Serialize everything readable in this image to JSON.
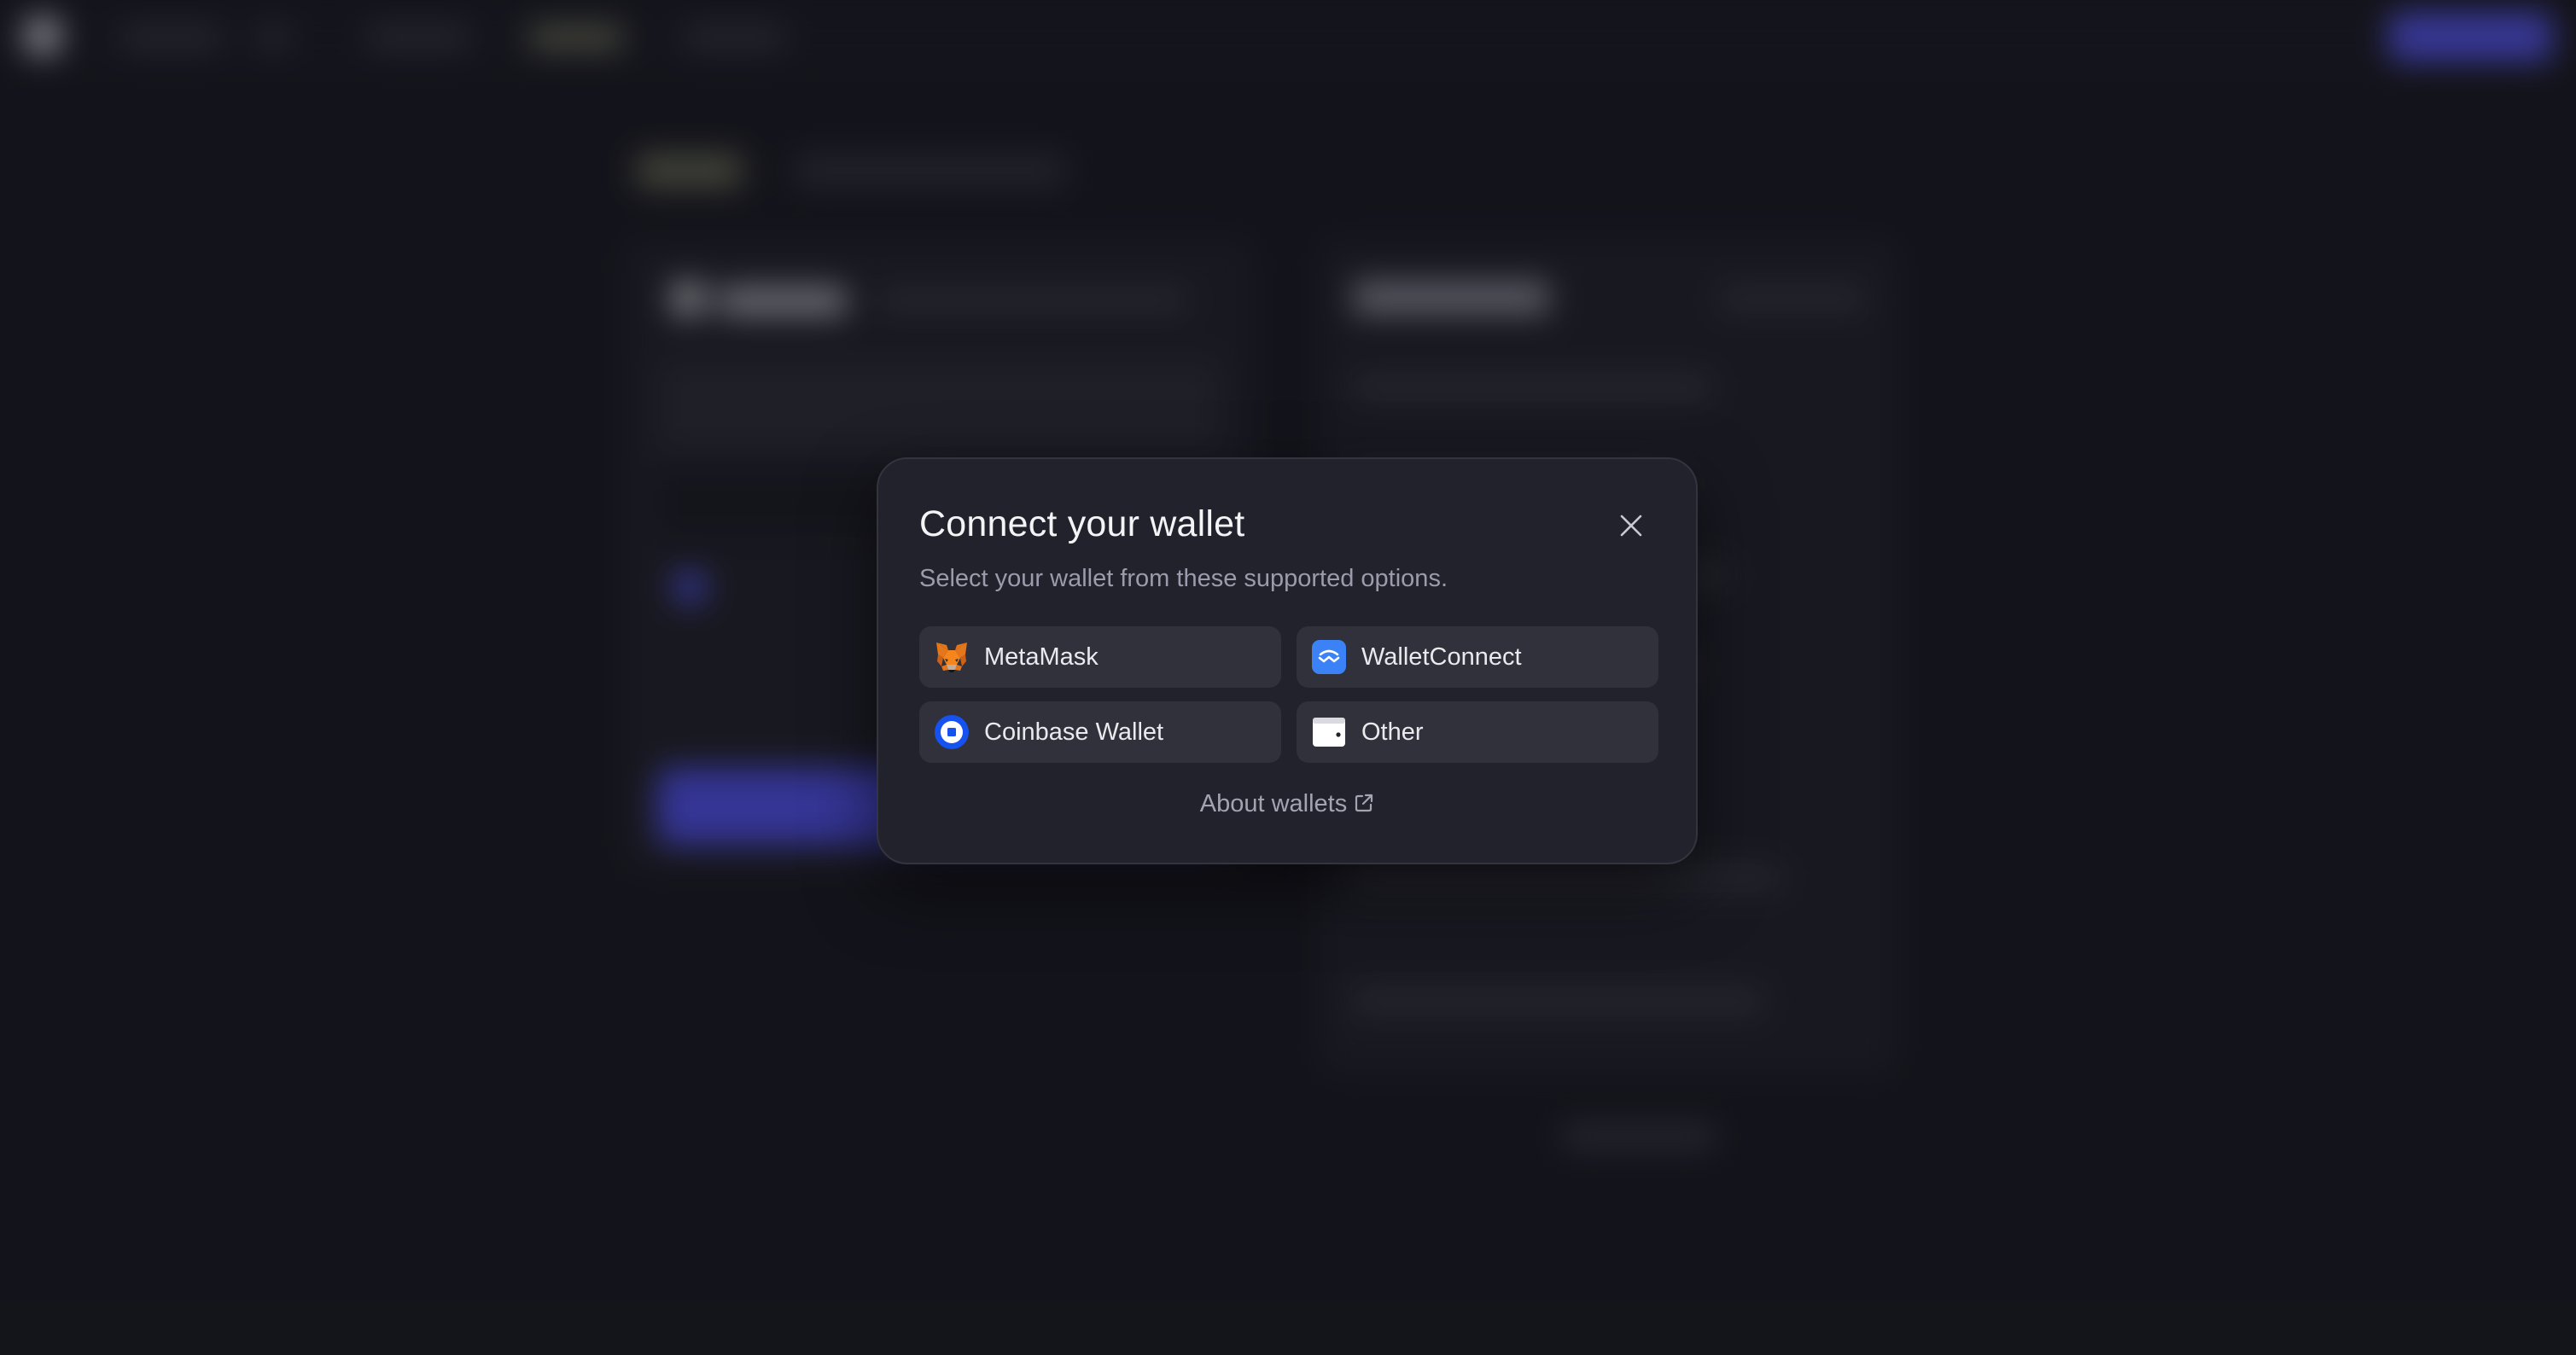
{
  "modal": {
    "title": "Connect your wallet",
    "subtitle": "Select your wallet from these supported options.",
    "close_icon": "close-icon",
    "wallets": [
      {
        "label": "MetaMask",
        "icon": "metamask-fox-icon"
      },
      {
        "label": "WalletConnect",
        "icon": "walletconnect-icon"
      },
      {
        "label": "Coinbase Wallet",
        "icon": "coinbase-wallet-icon"
      },
      {
        "label": "Other",
        "icon": "wallet-icon"
      }
    ],
    "about_link": "About wallets",
    "about_link_icon": "external-link-icon"
  },
  "colors": {
    "background": "#1a1a22",
    "modal_bg": "#22222c",
    "button_bg": "#31313c",
    "accent": "#5b5bff",
    "walletconnect_blue": "#3b82f6",
    "coinbase_blue": "#1652f0"
  }
}
